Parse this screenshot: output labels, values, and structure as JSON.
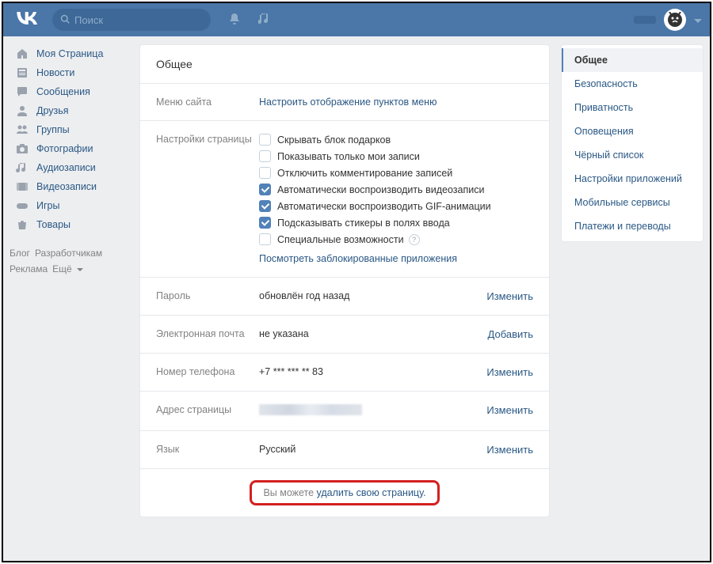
{
  "search": {
    "placeholder": "Поиск"
  },
  "nav": [
    {
      "label": "Моя Страница"
    },
    {
      "label": "Новости"
    },
    {
      "label": "Сообщения"
    },
    {
      "label": "Друзья"
    },
    {
      "label": "Группы"
    },
    {
      "label": "Фотографии"
    },
    {
      "label": "Аудиозаписи"
    },
    {
      "label": "Видеозаписи"
    },
    {
      "label": "Игры"
    },
    {
      "label": "Товары"
    }
  ],
  "footer": {
    "blog": "Блог",
    "dev": "Разработчикам",
    "ads": "Реклама",
    "more": "Ещё"
  },
  "settings": {
    "title": "Общее",
    "site_menu": {
      "label": "Меню сайта",
      "link": "Настроить отображение пунктов меню"
    },
    "page_settings": {
      "label": "Настройки страницы",
      "opts": [
        {
          "label": "Скрывать блок подарков",
          "checked": false
        },
        {
          "label": "Показывать только мои записи",
          "checked": false
        },
        {
          "label": "Отключить комментирование записей",
          "checked": false
        },
        {
          "label": "Автоматически воспроизводить видеозаписи",
          "checked": true
        },
        {
          "label": "Автоматически воспроизводить GIF-анимации",
          "checked": true
        },
        {
          "label": "Подсказывать стикеры в полях ввода",
          "checked": true
        },
        {
          "label": "Специальные возможности",
          "checked": false,
          "help": true
        }
      ],
      "blocked_link": "Посмотреть заблокированные приложения"
    },
    "password": {
      "label": "Пароль",
      "value": "обновлён год назад",
      "action": "Изменить"
    },
    "email": {
      "label": "Электронная почта",
      "value": "не указана",
      "action": "Добавить"
    },
    "phone": {
      "label": "Номер телефона",
      "value": "+7 *** *** ** 83",
      "action": "Изменить"
    },
    "address": {
      "label": "Адрес страницы",
      "action": "Изменить"
    },
    "language": {
      "label": "Язык",
      "value": "Русский",
      "action": "Изменить"
    },
    "delete": {
      "prefix": "Вы можете ",
      "link": "удалить свою страницу."
    }
  },
  "rightnav": [
    "Общее",
    "Безопасность",
    "Приватность",
    "Оповещения",
    "Чёрный список",
    "Настройки приложений",
    "Мобильные сервисы",
    "Платежи и переводы"
  ]
}
